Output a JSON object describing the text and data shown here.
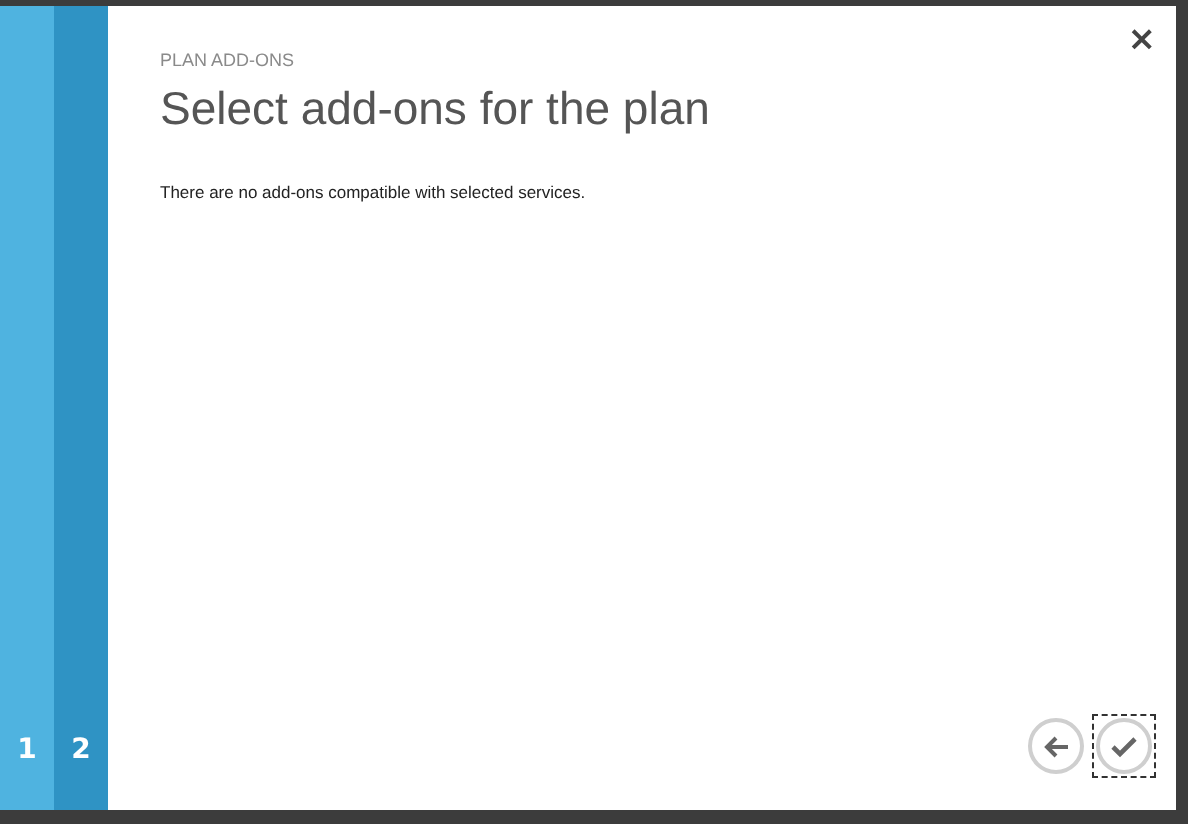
{
  "steps": [
    {
      "label": "1",
      "selected": false
    },
    {
      "label": "2",
      "selected": true
    }
  ],
  "close": "×",
  "section_label": "PLAN ADD-ONS",
  "title": "Select add-ons for the plan",
  "message": "There are no add-ons compatible with selected services.",
  "buttons": [
    {
      "kind": "back",
      "focused": false
    },
    {
      "kind": "finish",
      "focused": true
    }
  ]
}
